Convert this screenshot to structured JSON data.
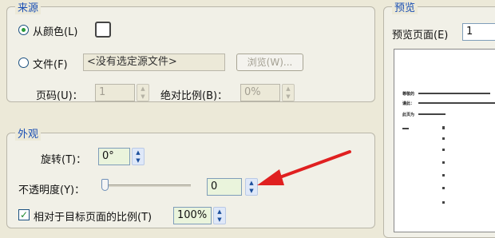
{
  "source_group": {
    "title": "来源",
    "from_color_label": "从颜色(L)",
    "from_file_label": "文件(F)",
    "file_value": "<没有选定源文件>",
    "browse_label": "浏览(W)...",
    "page_label": "页码(U)：",
    "page_value": "1",
    "absolute_scale_label": "绝对比例(B)：",
    "absolute_scale_value": "0%"
  },
  "appearance_group": {
    "title": "外观",
    "rotation_label": "旋转(T)：",
    "rotation_value": "0°",
    "opacity_label": "不透明度(Y)：",
    "opacity_value": "0",
    "opacity_level": 0,
    "relative_scale_label": "相对于目标页面的比例(T)",
    "relative_scale_value": "100%",
    "relative_scale_checked": true
  },
  "preview_group": {
    "title": "预览",
    "preview_page_label": "预览页面(E)",
    "preview_page_value": "1",
    "paper_text_1": "尊敬的",
    "paper_text_2": "谨此：",
    "paper_text_3": "此页为"
  },
  "annotation": {
    "arrow_color": "#e02020"
  },
  "colors": {
    "title_blue": "#1a4fb4",
    "window_bg": "#ece9d8",
    "field_green": "#eaf4dc"
  }
}
